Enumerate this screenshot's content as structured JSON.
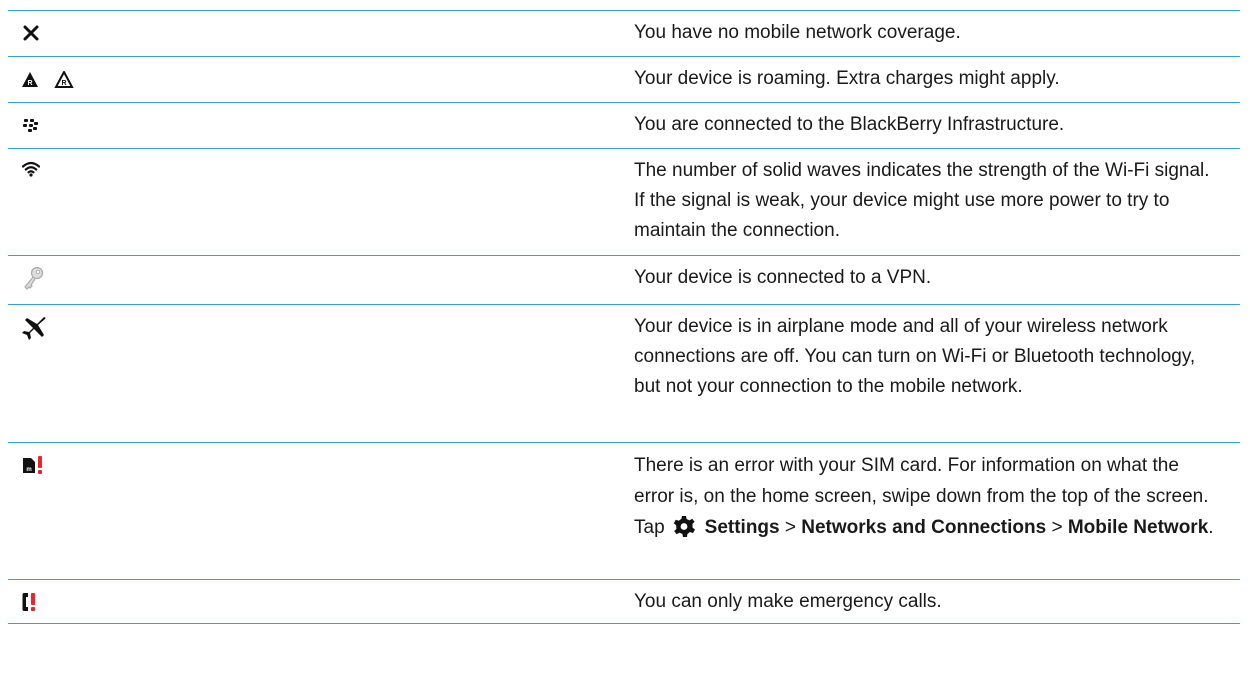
{
  "rows": [
    {
      "icon": "x-no-coverage-icon",
      "text": "You have no mobile network coverage."
    },
    {
      "icon": "roaming-triangle-icons",
      "text": "Your device is roaming. Extra charges might apply."
    },
    {
      "icon": "blackberry-logo-icon",
      "text": "You are connected to the BlackBerry Infrastructure."
    },
    {
      "icon": "wifi-icon",
      "text": "The number of solid waves indicates the strength of the Wi-Fi signal. If the signal is weak, your device might use more power to try to maintain the connection."
    },
    {
      "icon": "vpn-key-icon",
      "text": "Your device is connected to a VPN."
    },
    {
      "icon": "airplane-icon",
      "text": "Your device is in airplane mode and all of your wireless network connections are off. You can turn on Wi-Fi or Bluetooth technology, but not your connection to the mobile network."
    },
    {
      "icon": "sim-error-icon",
      "text_before": "There is an error with your SIM card. For information on what the error is, on the home screen, swipe down from the top of the screen. Tap",
      "settings": "Settings",
      "sep1": ">",
      "networks": "Networks and Connections",
      "sep2": ">",
      "mobile": "Mobile Network",
      "end": "."
    },
    {
      "icon": "emergency-calls-icon",
      "text": "You can only make emergency calls."
    }
  ],
  "colors": {
    "rule": "#3a9fd6",
    "alert": "#e8262c"
  }
}
